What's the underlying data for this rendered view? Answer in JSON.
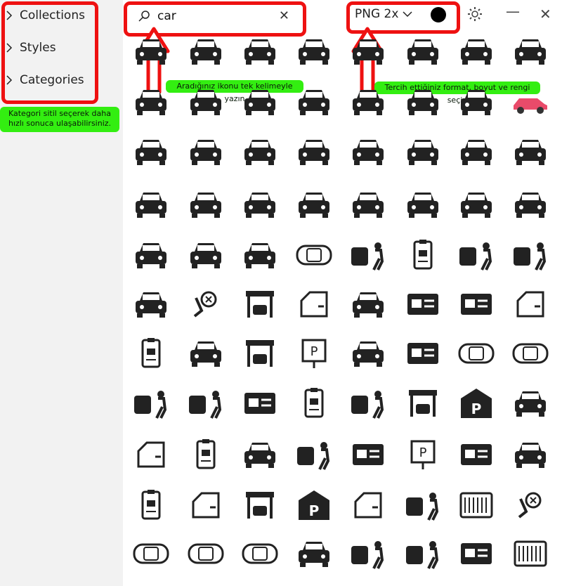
{
  "sidebar": {
    "items": [
      {
        "label": "Collections"
      },
      {
        "label": "Styles"
      },
      {
        "label": "Categories"
      }
    ]
  },
  "search": {
    "value": "car"
  },
  "toolbar": {
    "format_label": "PNG 2x",
    "color": "#000000"
  },
  "tips": {
    "sidebar": "Kategori sitil seçerek daha hızlı sonuca ulaşabilirsiniz.",
    "search": "Aradığınız ikonu tek kelimeyle yazın",
    "format": "Tercih ettiğiniz format, boyut ve rengi seçin"
  },
  "colors": {
    "highlight": "#ee1111",
    "tip_bg": "#33ee11",
    "sidebar_bg": "#f2f2f2"
  },
  "icons": [
    [
      "car-front-icon",
      "car-front-icon",
      "car-front-icon",
      "car-front-icon",
      "car-front-icon",
      "car-front-icon",
      "car-front-icon",
      "car-front-icon"
    ],
    [
      "car-front-icon",
      "car-front-icon",
      "car-front-icon",
      "car-front-icon",
      "car-front-icon",
      "car-front-icon",
      "car-front-icon",
      "car-side-icon"
    ],
    [
      "car-front-icon",
      "car-front-icon",
      "car-front-icon",
      "car-front-icon",
      "car-front-icon",
      "car-front-icon",
      "car-front-icon",
      "car-front-icon"
    ],
    [
      "car-front-icon",
      "car-front-icon",
      "car-front-icon",
      "car-front-icon",
      "car-front-icon",
      "car-front-icon",
      "car-front-icon",
      "car-front-icon"
    ],
    [
      "car-front-icon",
      "car-front-icon",
      "car-front-icon",
      "car-top-icon",
      "car-mechanic-icon",
      "id-badge-icon",
      "car-mechanic-icon",
      "car-mechanic-icon"
    ],
    [
      "car-front-icon",
      "airbag-icon",
      "garage-icon",
      "car-door-icon",
      "car-front-icon",
      "license-card-icon",
      "license-card-icon",
      "car-door-icon"
    ],
    [
      "id-badge-icon",
      "car-front-icon",
      "garage-icon",
      "parking-sign-icon",
      "car-front-icon",
      "license-card-icon",
      "car-top-icon",
      "car-top-icon"
    ],
    [
      "car-mechanic-icon",
      "car-mechanic-icon",
      "license-card-icon",
      "id-badge-icon",
      "car-mechanic-icon",
      "garage-icon",
      "parking-icon",
      "car-front-icon"
    ],
    [
      "car-door-icon",
      "id-badge-icon",
      "car-front-icon",
      "car-mechanic-icon",
      "license-card-icon",
      "parking-sign-icon",
      "license-card-icon",
      "car-front-icon"
    ],
    [
      "id-badge-icon",
      "car-door-icon",
      "garage-icon",
      "parking-icon",
      "car-door-icon",
      "car-mechanic-icon",
      "radiator-icon",
      "airbag-icon"
    ],
    [
      "car-top-icon",
      "car-top-icon",
      "car-top-icon",
      "car-front-icon",
      "car-mechanic-icon",
      "car-mechanic-icon",
      "license-card-icon",
      "radiator-icon"
    ]
  ]
}
